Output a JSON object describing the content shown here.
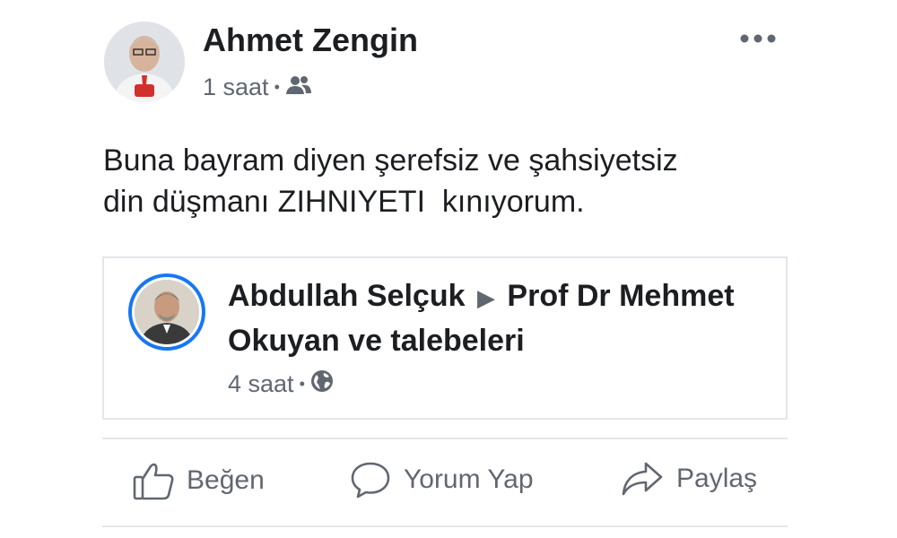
{
  "post": {
    "author": "Ahmet Zengin",
    "time": "1 saat",
    "separator": "•",
    "privacy_icon": "friends-icon",
    "text": "Buna bayram diyen şerefsiz ve şahsiyetsiz\ndin düşmanı ZIHNIYETI  kınıyorum.",
    "more_icon": "more-options-icon"
  },
  "shared": {
    "author": "Abdullah Selçuk",
    "arrow": "▶",
    "target": "Prof Dr Mehmet Okuyan ve talebeleri",
    "time": "4 saat",
    "separator": "•",
    "privacy_icon": "globe-icon",
    "avatar_ring_color": "#1877f2"
  },
  "actions": {
    "like": "Beğen",
    "comment": "Yorum Yap",
    "share": "Paylaş"
  },
  "colors": {
    "text": "#1c1e21",
    "secondary": "#606770",
    "divider": "#e4e6eb"
  }
}
